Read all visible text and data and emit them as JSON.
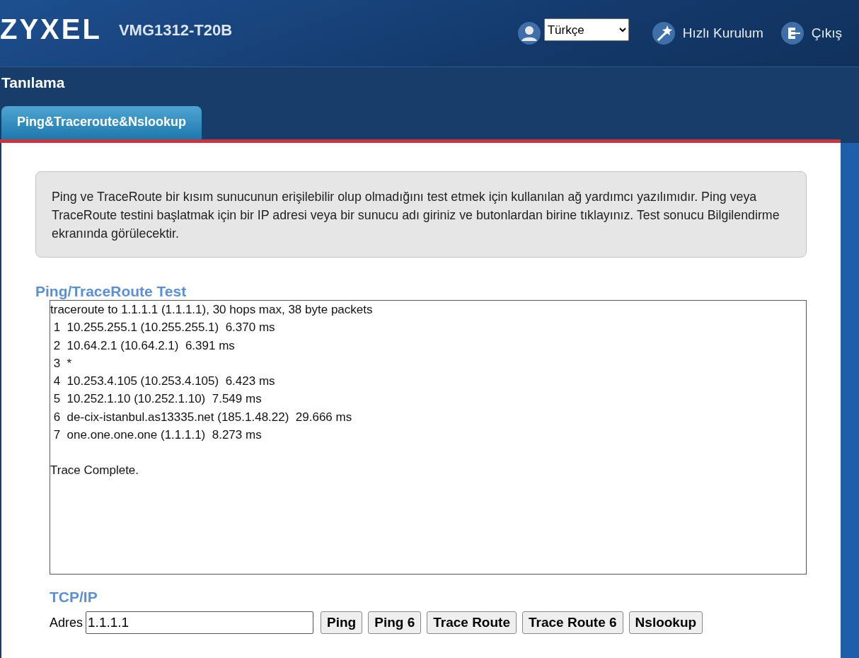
{
  "header": {
    "logo": "ZYXEL",
    "model": "VMG1312-T20B",
    "language": "Türkçe",
    "quick_setup": "Hızlı Kurulum",
    "logout": "Çıkış"
  },
  "page_title": "Tanılama",
  "tabs": [
    {
      "label": "Ping&Traceroute&Nslookup",
      "selected": true
    }
  ],
  "info": "Ping ve TraceRoute bir kısım sunucunun erişilebilir olup olmadığını test etmek için kullanılan ağ yardımcı yazılımıdır. Ping veya TraceRoute testini başlatmak için bir IP adresi veya bir sunucu adı giriniz ve butonlardan birine tıklayınız. Test sonucu Bilgilendirme ekranında görülecektir.",
  "test_section": {
    "title": "Ping/TraceRoute Test",
    "output_lines": [
      "traceroute to 1.1.1.1 (1.1.1.1), 30 hops max, 38 byte packets",
      " 1  10.255.255.1 (10.255.255.1)  6.370 ms",
      " 2  10.64.2.1 (10.64.2.1)  6.391 ms",
      " 3  *",
      " 4  10.253.4.105 (10.253.4.105)  6.423 ms",
      " 5  10.252.1.10 (10.252.1.10)  7.549 ms",
      " 6  de-cix-istanbul.as13335.net (185.1.48.22)  29.666 ms",
      " 7  one.one.one.one (1.1.1.1)  8.273 ms"
    ],
    "output_summary": "Trace Complete."
  },
  "tcpip": {
    "title": "TCP/IP",
    "address_label": "Adres",
    "address_value": "1.1.1.1",
    "buttons": [
      "Ping",
      "Ping 6",
      "Trace Route",
      "Trace Route 6",
      "Nslookup"
    ]
  }
}
